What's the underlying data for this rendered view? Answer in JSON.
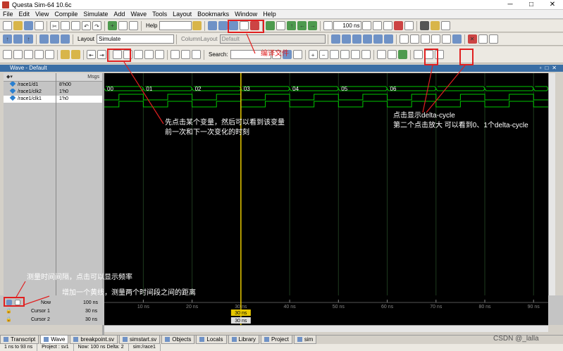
{
  "window": {
    "title": "Questa Sim-64 10.6c",
    "controls": [
      "─",
      "□",
      "✕"
    ]
  },
  "menu": [
    "File",
    "Edit",
    "View",
    "Compile",
    "Simulate",
    "Add",
    "Wave",
    "Tools",
    "Layout",
    "Bookmarks",
    "Window",
    "Help"
  ],
  "toolbar1": {
    "help_label": "Help",
    "run_length": "100 ns"
  },
  "toolbar2": {
    "layout_label": "Layout",
    "layout_value": "Simulate",
    "column_layout_label": "ColumnLayout",
    "column_layout_value": "Default"
  },
  "toolbar3": {
    "search_label": "Search:"
  },
  "wave_window": {
    "title": "Wave - Default",
    "msgs_header": "Msgs"
  },
  "signals": [
    {
      "name": "/race1/d1",
      "value": "8'h00"
    },
    {
      "name": "/race1/clk2",
      "value": "1'h0"
    },
    {
      "name": "/race1/clk1",
      "value": "1'h0"
    }
  ],
  "bus_values": [
    "00",
    "01",
    "02",
    "03",
    "04",
    "05",
    "06"
  ],
  "cursor_pane": {
    "now_label": "Now",
    "now_value": "100 ns",
    "cursor1_label": "Cursor 1",
    "cursor1_value": "30 ns",
    "cursor2_label": "Cursor 2",
    "cursor2_value": "30 ns",
    "cursor1_marker": "30 ns",
    "cursor2_marker": "30 ns"
  },
  "time_axis": [
    "10 ns",
    "20 ns",
    "30 ns",
    "40 ns",
    "50 ns",
    "60 ns",
    "70 ns",
    "80 ns",
    "90 ns"
  ],
  "tabs": [
    {
      "label": "Transcript"
    },
    {
      "label": "Wave"
    },
    {
      "label": "breakpoint.sv"
    },
    {
      "label": "simstart.sv"
    },
    {
      "label": "Objects"
    },
    {
      "label": "Locals"
    },
    {
      "label": "Library"
    },
    {
      "label": "Project"
    },
    {
      "label": "sim"
    }
  ],
  "status": [
    "1 ns to 93 ns",
    "Project : sv1",
    "Now: 100 ns  Delta: 2",
    "sim:/race1"
  ],
  "annotations": {
    "compile": "编译文件",
    "click_var_1": "先点击某个变量，然后可以看到该变量",
    "click_var_2": "前一次和下一次变化的时刻",
    "delta_1": "点击显示delta-cycle",
    "delta_2": "第二个点击放大 可以看到0、1个delta-cycle",
    "measure": "测量时间间隔，点击可以显示频率",
    "cursor": "增加一个黄线，测量两个时间段之间的距离"
  },
  "watermark": "CSDN @_lalla",
  "colors": {
    "annotation": "#e02020",
    "wave_green": "#00c800",
    "cursor_yellow": "#e8c800",
    "grid": "#1e3a1e"
  }
}
